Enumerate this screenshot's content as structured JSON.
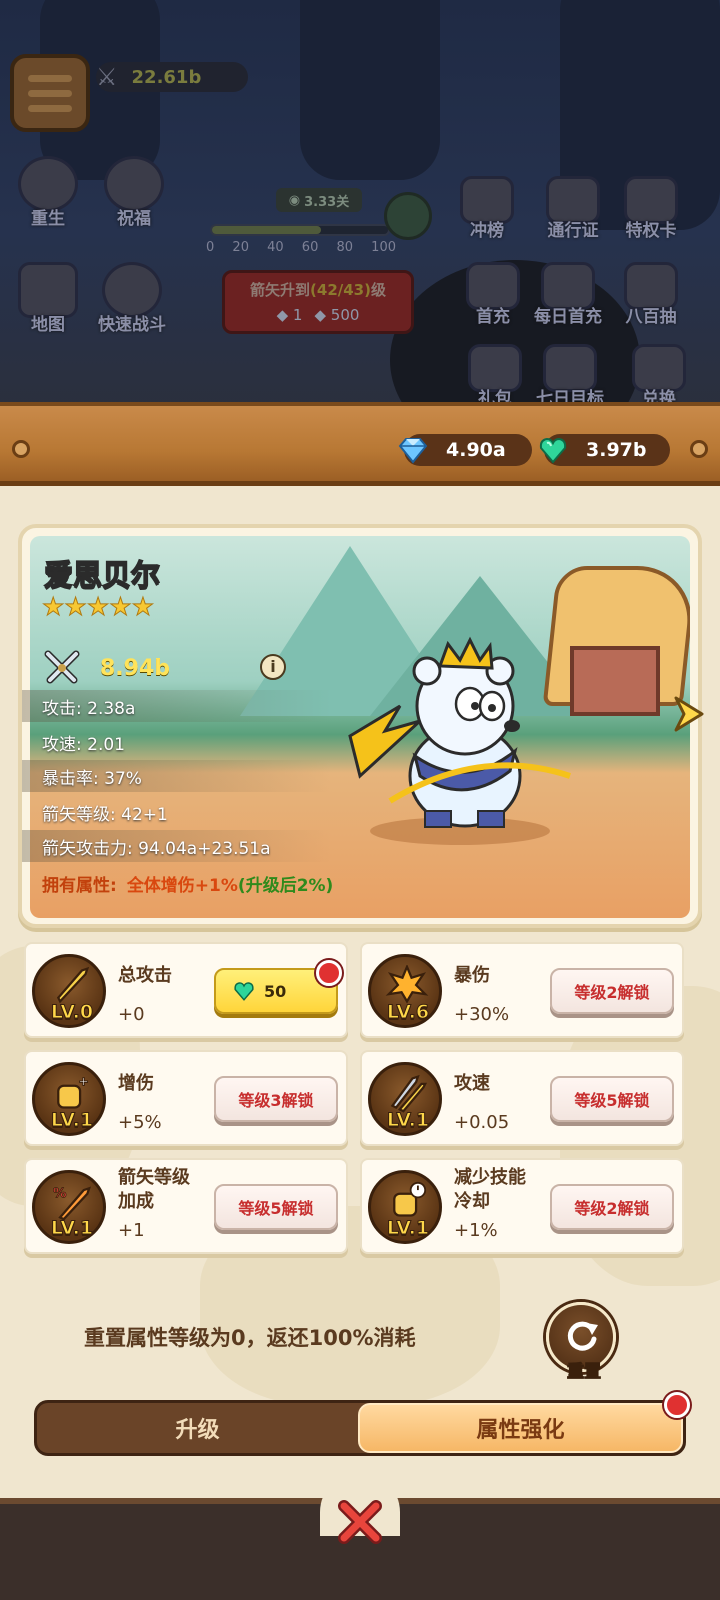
{
  "background": {
    "power_value": "22.61b",
    "stage_label": "3.33关",
    "progress_ticks": [
      "0",
      "20",
      "40",
      "60",
      "80",
      "100"
    ],
    "progress_fraction": 0.62,
    "arrow_upgrade": {
      "prefix": "箭矢升到",
      "level": "(42/43)",
      "suffix": "级",
      "cost_a": "1",
      "cost_b": "500"
    },
    "left_buttons": [
      {
        "label": "重生",
        "icon": "rebirth-icon"
      },
      {
        "label": "祝福",
        "icon": "blessing-icon"
      },
      {
        "label": "地图",
        "icon": "map-icon"
      },
      {
        "label": "快速战斗",
        "icon": "quick-battle-icon"
      }
    ],
    "right_buttons": [
      {
        "label": "冲榜",
        "icon": "ranking-icon"
      },
      {
        "label": "通行证",
        "icon": "pass-icon"
      },
      {
        "label": "特权卡",
        "icon": "privilege-card-icon"
      },
      {
        "label": "首充",
        "icon": "first-charge-icon"
      },
      {
        "label": "每日首充",
        "icon": "daily-charge-icon"
      },
      {
        "label": "八百抽",
        "icon": "draw-icon"
      },
      {
        "label": "礼包",
        "icon": "gift-pack-icon"
      },
      {
        "label": "七日目标",
        "icon": "seven-day-icon"
      },
      {
        "label": "兑换",
        "icon": "exchange-icon"
      }
    ]
  },
  "currency": {
    "diamond": "4.90a",
    "emerald": "3.97b",
    "diamond_color": "#6ec6ff",
    "emerald_color": "#2fd59a"
  },
  "hero": {
    "name": "爱思贝尔",
    "stars": 5,
    "power": "8.94b",
    "stats": [
      {
        "text": "攻击: 2.38a"
      },
      {
        "text": "攻速: 2.01"
      },
      {
        "text": "暴击率: 37%"
      },
      {
        "text": "箭矢等级: 42+1"
      },
      {
        "text": "箭矢攻击力: 94.04a+23.51a"
      }
    ],
    "trait_label": "拥有属性:",
    "trait_value": "全体增伤+1%",
    "trait_value_next": "(升级后2%)"
  },
  "attributes": [
    {
      "name": "总攻击",
      "level": "LV.0",
      "value": "+0",
      "button": "50",
      "button_type": "buy",
      "icon": "sword-icon",
      "red_dot": true
    },
    {
      "name": "暴伤",
      "level": "LV.6",
      "value": "+30%",
      "button": "等级2解锁",
      "button_type": "locked",
      "icon": "crit-burst-icon",
      "red_dot": false
    },
    {
      "name": "增伤",
      "level": "LV.1",
      "value": "+5%",
      "button": "等级3解锁",
      "button_type": "locked",
      "icon": "fist-plus-icon",
      "red_dot": false
    },
    {
      "name": "攻速",
      "level": "LV.1",
      "value": "+0.05",
      "button": "等级5解锁",
      "button_type": "locked",
      "icon": "arrows-icon",
      "red_dot": false
    },
    {
      "name": "箭矢等级加成",
      "name_lines": [
        "箭矢等级",
        "加成"
      ],
      "level": "LV.1",
      "value": "+1",
      "button": "等级5解锁",
      "button_type": "locked",
      "icon": "percent-arrow-icon",
      "red_dot": false
    },
    {
      "name": "减少技能冷却",
      "name_lines": [
        "减少技能",
        "冷却"
      ],
      "level": "LV.1",
      "value": "+1%",
      "button": "等级2解锁",
      "button_type": "locked",
      "icon": "cooldown-fist-icon",
      "red_dot": false
    }
  ],
  "reset": {
    "description": "重置属性等级为0，返还100%消耗",
    "button": "重置"
  },
  "tabs": [
    {
      "label": "升级",
      "active": false
    },
    {
      "label": "属性强化",
      "active": true
    }
  ]
}
